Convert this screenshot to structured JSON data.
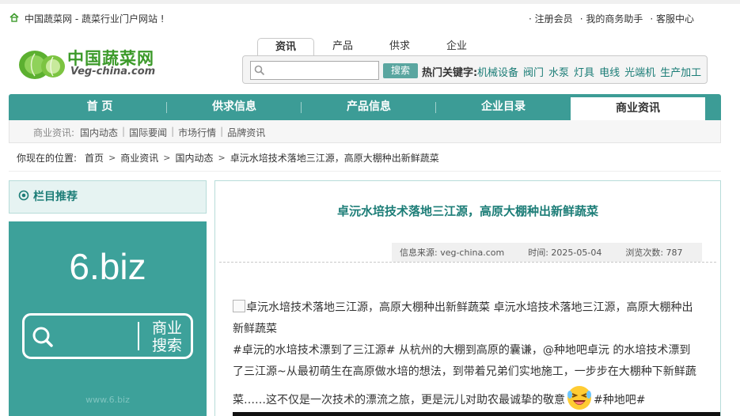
{
  "topbar": {
    "site_label": "中国蔬菜网 - 蔬菜行业门户网站 !",
    "links": [
      "注册会员",
      "我的商务助手",
      "客服中心"
    ]
  },
  "logo": {
    "cn": "中国蔬菜网",
    "en": "Veg-china.com"
  },
  "search": {
    "tabs": [
      "资讯",
      "产品",
      "供求",
      "企业"
    ],
    "active_tab": 0,
    "input_value": "",
    "button_label": "搜索",
    "hot_label": "热门关键字:",
    "hot_words": [
      "机械设备",
      "阀门",
      "水泵",
      "灯具",
      "电线",
      "光端机",
      "生产加工"
    ]
  },
  "mainnav": {
    "items": [
      "首 页",
      "供求信息",
      "产品信息",
      "企业目录",
      "商业资讯"
    ],
    "active": 4
  },
  "subnav": {
    "label": "商业资讯:",
    "items": [
      "国内动态",
      "国际要闻",
      "市场行情",
      "品牌资讯"
    ]
  },
  "breadcrumb": {
    "prefix": "你现在的位置:",
    "items": [
      "首页",
      "商业资讯",
      "国内动态",
      "卓沅水培技术落地三江源，高原大棚种出新鲜蔬菜"
    ]
  },
  "sidebar": {
    "title": "栏目推荐"
  },
  "ad": {
    "big_text": "6.biz",
    "box_label": "商业搜索",
    "url": "www.6.biz"
  },
  "article": {
    "title": "卓沅水培技术落地三江源，高原大棚种出新鲜蔬菜",
    "meta": {
      "source": "信息来源: veg-china.com",
      "time": "时间: 2025-05-04",
      "views": "浏览次数: 787"
    },
    "img_alt": "卓沅水培技术落地三江源，高原大棚种出新鲜蔬菜",
    "para1_tail": " 卓沅水培技术落地三江源，高原大棚种出新鲜蔬菜",
    "para2": "#卓沅的水培技术漂到了三江源# 从杭州的大棚到高原的囊谦，@种地吧卓沅 的水培技术漂到了三江源~从最初萌生在高原做水培的想法，到带着兄弟们实地施工，一步步在大棚种下新鲜蔬菜……这不仅是一次技术的漂流之旅，更是沅儿对助农最诚挚的敬意",
    "para2_end": "#种地吧#"
  },
  "colors": {
    "teal": "#3c9c96",
    "teal_dark": "#1c7d77",
    "logo_green": "#3c9a2a"
  }
}
